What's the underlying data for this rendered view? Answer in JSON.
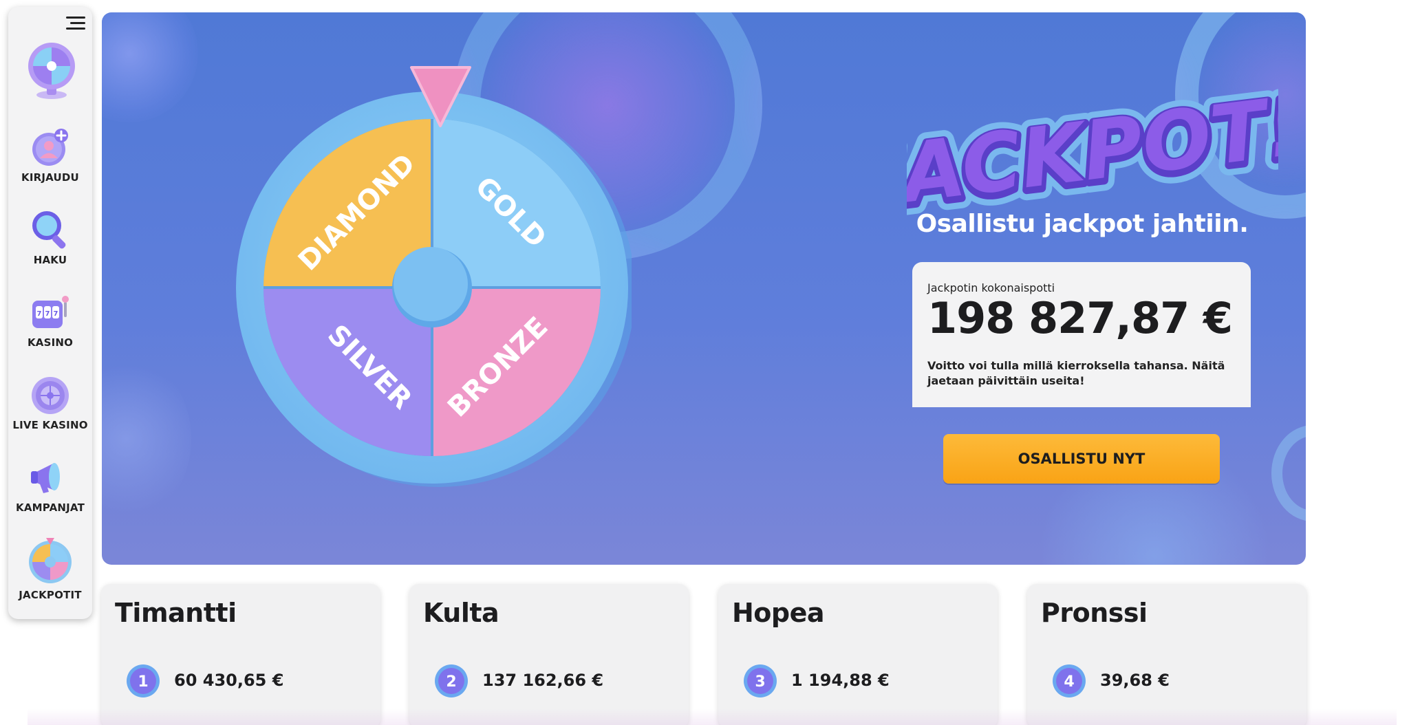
{
  "sidebar": {
    "menu_icon": "hamburger-menu-icon",
    "logo_icon": "prize-wheel-logo-icon",
    "items": [
      {
        "label": "KIRJAUDU",
        "icon": "user-add-icon"
      },
      {
        "label": "HAKU",
        "icon": "magnifier-icon"
      },
      {
        "label": "KASINO",
        "icon": "slot-machine-icon"
      },
      {
        "label": "LIVE KASINO",
        "icon": "roulette-icon"
      },
      {
        "label": "KAMPANJAT",
        "icon": "megaphone-icon"
      },
      {
        "label": "JACKPOTIT",
        "icon": "jackpot-wheel-icon"
      }
    ]
  },
  "hero": {
    "wheel_segments": [
      "DIAMOND",
      "GOLD",
      "SILVER",
      "BRONZE"
    ],
    "logo_text": "JACKPOT!",
    "subtitle": "Osallistu jackpot jahtiin.",
    "pot": {
      "label": "Jackpotin kokonaispotti",
      "amount": "198 827,87 €",
      "description": "Voitto voi tulla millä kierroksella tahansa. Näitä jaetaan päivittäin useita!"
    },
    "cta_label": "OSALLISTU NYT"
  },
  "tiers": [
    {
      "title": "Timantti",
      "rank": "1",
      "value": "60 430,65 €"
    },
    {
      "title": "Kulta",
      "rank": "2",
      "value": "137 162,66 €"
    },
    {
      "title": "Hopea",
      "rank": "3",
      "value": "1 194,88 €"
    },
    {
      "title": "Pronssi",
      "rank": "4",
      "value": "39,68 €"
    }
  ],
  "colors": {
    "hero_bg": "#5079d6",
    "cta": "#f9a315",
    "wheel_diamond": "#f6bf52",
    "wheel_gold": "#8dcdf7",
    "wheel_silver": "#9c8cf0",
    "wheel_bronze": "#ef99c8",
    "jackpot_text": "#8c5ce8"
  }
}
